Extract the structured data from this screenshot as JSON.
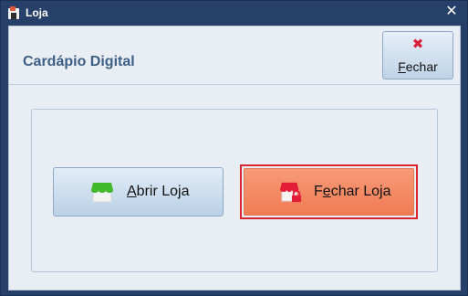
{
  "window": {
    "title": "Loja"
  },
  "header": {
    "title": "Cardápio Digital",
    "close_button": {
      "icon": "x-icon",
      "label": "Fechar"
    }
  },
  "actions": {
    "open_store": {
      "label": "Abrir Loja",
      "icon": "open-store-icon",
      "accent": "#41b82a"
    },
    "close_store": {
      "label": "Fechar Loja",
      "icon": "closed-store-icon",
      "accent": "#e31c38"
    }
  },
  "colors": {
    "titlebar": "#26406a",
    "client_background": "#e9eef5",
    "header_text": "#3e5f85",
    "close_store_button": "#f48a62",
    "focus_border": "#d9252f"
  }
}
